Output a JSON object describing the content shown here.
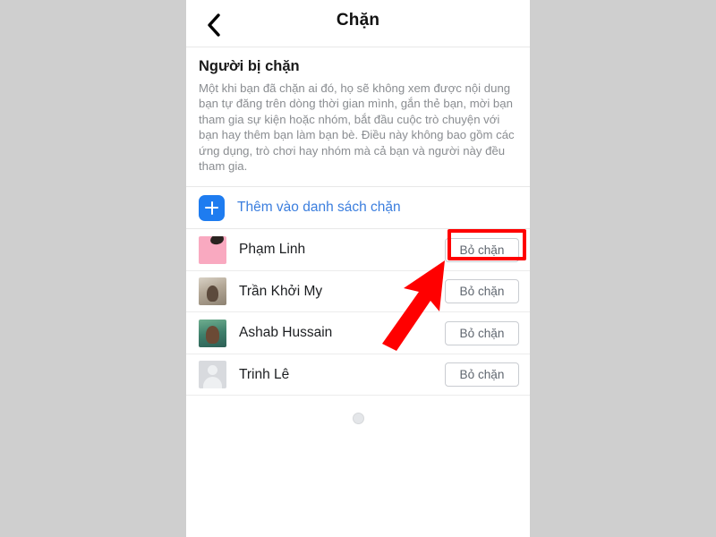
{
  "app": {
    "platform_background": "#cfcfcf",
    "panel_background": "#ffffff"
  },
  "navbar": {
    "back_icon": "chevron-left-icon",
    "title": "Chặn"
  },
  "section": {
    "title": "Người bị chặn",
    "description": "Một khi bạn đã chặn ai đó, họ sẽ không xem được nội dung bạn tự đăng trên dòng thời gian mình, gắn thẻ bạn, mời bạn tham gia sự kiện hoặc nhóm, bắt đầu cuộc trò chuyện với bạn hay thêm bạn làm bạn bè. Điều này không bao gồm các ứng dụng, trò chơi hay nhóm mà cả bạn và người này đều tham gia."
  },
  "add_row": {
    "icon": "plus-square-icon",
    "label": "Thêm vào danh sách chặn",
    "accent_color": "#1e7cf0",
    "label_color": "#3b7ede"
  },
  "blocked_list": [
    {
      "name": "Phạm Linh",
      "avatar_style": "pink",
      "action_label": "Bỏ chặn",
      "highlighted": true
    },
    {
      "name": "Trần Khởi My",
      "avatar_style": "beige",
      "action_label": "Bỏ chặn",
      "highlighted": false
    },
    {
      "name": "Ashab Hussain",
      "avatar_style": "teal",
      "action_label": "Bỏ chặn",
      "highlighted": false
    },
    {
      "name": "Trinh Lê",
      "avatar_style": "silhouette",
      "action_label": "Bỏ chặn",
      "highlighted": false
    }
  ],
  "loading": {
    "indicator": "loading-dot"
  },
  "annotation": {
    "color": "#ff0000",
    "arrow": "callout-arrow-up-right",
    "highlight_target": "Bỏ chặn"
  }
}
